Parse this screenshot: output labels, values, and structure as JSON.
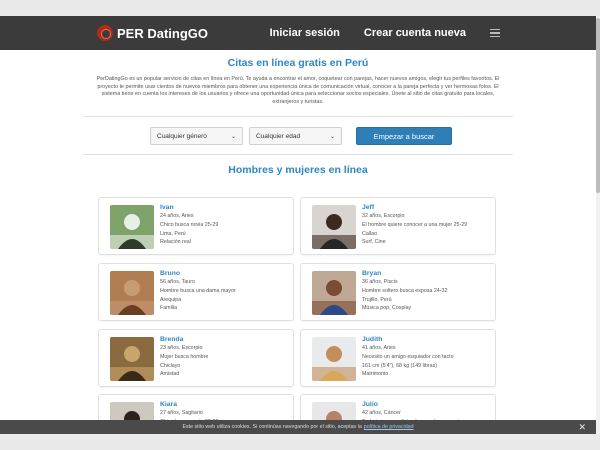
{
  "header": {
    "logo_text": "PER DatingGO",
    "nav": {
      "login": "Iniciar sesión",
      "signup": "Crear cuenta nueva"
    }
  },
  "intro": {
    "title": "Citas en línea gratis en Perú",
    "text": "PerDatingGo es un popular servicio de citas en línea en Perú. Te ayuda a encontrar el amor, coquetear con parejas, hacer nuevos amigos, elegir tus perfiles favoritos. El proyecto te permite usar cientos de nuevos miembros para obtener una experiencia única de comunicación virtual, conocer a la pareja perfecta y ver hermosas fotos. El sistema tiene en cuenta los intereses de los usuarios y ofrece una oportunidad única para seleccionar socios especiales. Únete al sitio de citas gratuito para locales, extranjeros y turistas."
  },
  "search": {
    "gender": "Cualquier género",
    "age": "Cualquier edad",
    "button": "Empezar a buscar"
  },
  "section_title": "Hombres y mujeres en línea",
  "profiles": [
    {
      "name": "Ivan",
      "lines": [
        "24 años, Aries",
        "Chico busca novia 25-29",
        "Lima, Perú",
        "Relación real"
      ],
      "colors": [
        "#7da36b",
        "#e8efe6",
        "#2d3b2a"
      ]
    },
    {
      "name": "Jeff",
      "lines": [
        "32 años, Escorpio",
        "El hombre quiere conocer a una mujer 25-29",
        "Callao",
        "Surf, Cine"
      ],
      "colors": [
        "#d9d4cf",
        "#3a2a22",
        "#262626"
      ]
    },
    {
      "name": "Bruno",
      "lines": [
        "56 años, Tauro",
        "Hombre busca una dama mayor",
        "Arequipa",
        "Familia"
      ],
      "colors": [
        "#b07c52",
        "#c79b74",
        "#6b3f24"
      ]
    },
    {
      "name": "Bryan",
      "lines": [
        "36 años, Piscis",
        "Hombre soltero busca esposa 24-32",
        "Trujillo, Perú",
        "Música pop, Cosplay"
      ],
      "colors": [
        "#bfa894",
        "#7a4b36",
        "#2c4a86"
      ]
    },
    {
      "name": "Brenda",
      "lines": [
        "23 años, Escorpio",
        "Mujer busca hombre",
        "Chiclayo",
        "Amistad"
      ],
      "colors": [
        "#8a6a3e",
        "#c9a46d",
        "#3a2a1a"
      ]
    },
    {
      "name": "Judith",
      "lines": [
        "41 años, Aries",
        "Necesito un amigo esquiador con tacto",
        "161 cm (5'4\"), 68 kg (149 libras)",
        "Matrimonio"
      ],
      "colors": [
        "#e8eaec",
        "#c58d5b",
        "#d7a85a"
      ]
    },
    {
      "name": "Kiara",
      "lines": [
        "27 años, Sagitario",
        "Chica busca novio 32-38",
        "Huancayo, Perú"
      ],
      "colors": [
        "#cfc8c1",
        "#2b2320",
        "#5a3a2a"
      ]
    },
    {
      "name": "Julio",
      "lines": [
        "42 años, Cáncer",
        "Trabajo en una clínica buscando una mujer",
        "Cusco"
      ],
      "colors": [
        "#e7e7e7",
        "#b9816a",
        "#2d3e73"
      ]
    }
  ],
  "cookie": {
    "text": "Este sitio web utiliza cookies. Si continúas navegando por el sitio, aceptas la",
    "link": "política de privacidad",
    "close": "✕"
  }
}
